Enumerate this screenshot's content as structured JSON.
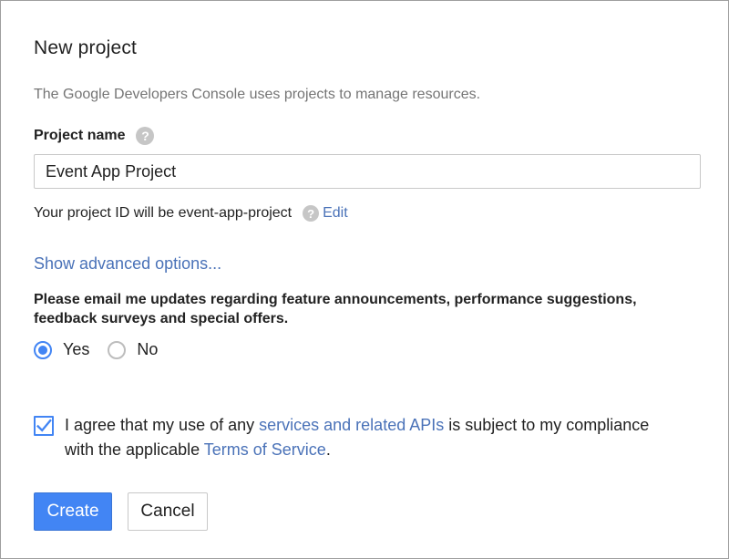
{
  "dialog": {
    "title": "New project",
    "intro": "The Google Developers Console uses projects to manage resources."
  },
  "project_name": {
    "label": "Project name",
    "help_icon": "question-icon",
    "value": "Event App Project"
  },
  "project_id": {
    "text": "Your project ID will be event-app-project",
    "help_icon": "question-icon",
    "edit_label": "Edit"
  },
  "advanced": {
    "label": "Show advanced options..."
  },
  "email_updates": {
    "prompt": "Please email me updates regarding feature announcements, performance suggestions, feedback surveys and special offers.",
    "options": [
      {
        "label": "Yes",
        "selected": true
      },
      {
        "label": "No",
        "selected": false
      }
    ]
  },
  "agreement": {
    "checked": true,
    "text_before": "I agree that my use of any ",
    "link1": "services and related APIs",
    "text_middle": " is subject to my compliance with the applicable ",
    "link2": "Terms of Service",
    "text_after": "."
  },
  "buttons": {
    "create": "Create",
    "cancel": "Cancel"
  },
  "colors": {
    "accent": "#4285f4",
    "link": "#4a72b8",
    "muted_text": "#757575"
  }
}
